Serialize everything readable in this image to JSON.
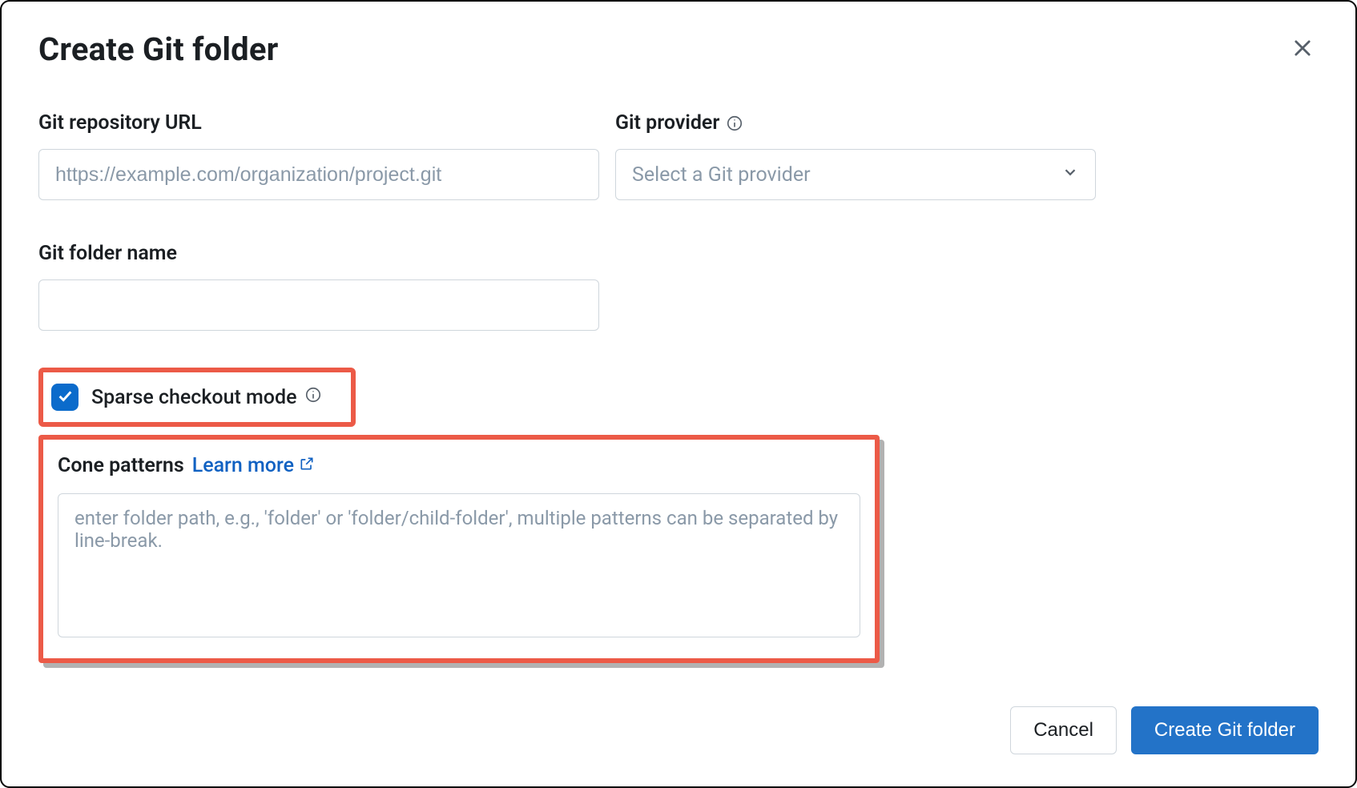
{
  "dialog": {
    "title": "Create Git folder"
  },
  "fields": {
    "repo_url": {
      "label": "Git repository URL",
      "placeholder": "https://example.com/organization/project.git",
      "value": ""
    },
    "provider": {
      "label": "Git provider",
      "placeholder": "Select a Git provider",
      "value": ""
    },
    "folder_name": {
      "label": "Git folder name",
      "value": ""
    }
  },
  "sparse": {
    "label": "Sparse checkout mode",
    "checked": true
  },
  "cone": {
    "title": "Cone patterns",
    "learn_more_label": "Learn more",
    "placeholder": "enter folder path, e.g., 'folder' or 'folder/child-folder', multiple patterns can be separated by line-break.",
    "value": ""
  },
  "footer": {
    "cancel_label": "Cancel",
    "submit_label": "Create Git folder"
  },
  "highlight_color": "#ec5a47",
  "icons": {
    "close": "close-icon",
    "info": "info-icon",
    "chevron_down": "chevron-down-icon",
    "check": "check-icon",
    "external": "external-link-icon"
  }
}
